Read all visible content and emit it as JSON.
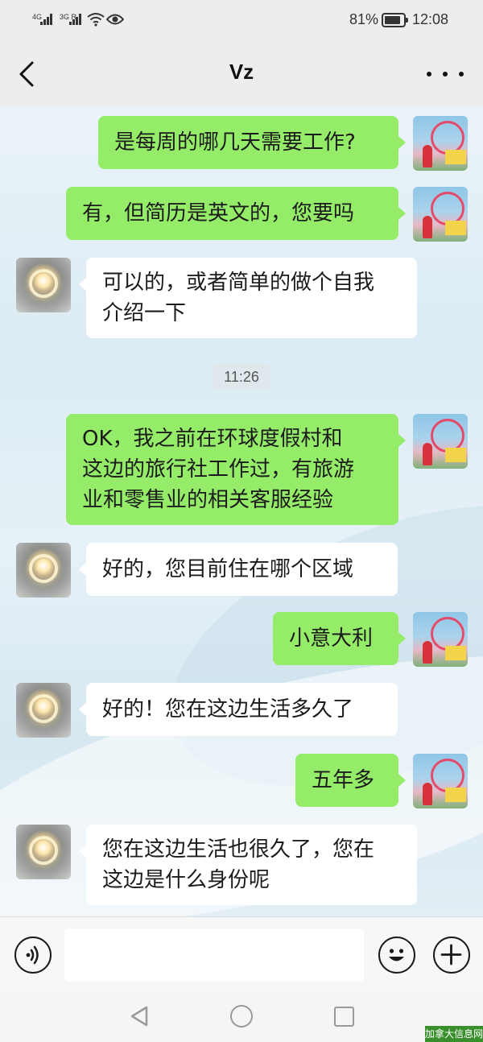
{
  "status_bar": {
    "sim1_label": "4G",
    "sim2_label": "3G R",
    "battery_percent": "81%",
    "time": "12:08",
    "icons": [
      "signal-4g-icon",
      "signal-3g-roaming-icon",
      "wifi-icon",
      "eye-comfort-icon",
      "battery-icon"
    ]
  },
  "header": {
    "title": "Vz",
    "back_icon": "chevron-left-icon",
    "more_icon": "more-dots-icon"
  },
  "messages": [
    {
      "sender": "self",
      "lines": [
        "是每周的哪几天需要工作?"
      ]
    },
    {
      "sender": "self",
      "lines": [
        "有，但简历是英文的，您要吗"
      ]
    },
    {
      "sender": "other",
      "lines": [
        "可以的，或者简单的做个自我",
        "介绍一下"
      ]
    },
    {
      "sender": "self",
      "lines": [
        "OK，我之前在环球度假村和",
        "这边的旅行社工作过，有旅游",
        "业和零售业的相关客服经验"
      ]
    },
    {
      "sender": "other",
      "lines": [
        "好的，您目前住在哪个区域"
      ]
    },
    {
      "sender": "self",
      "lines": [
        "小意大利"
      ]
    },
    {
      "sender": "other",
      "lines": [
        "好的！您在这边生活多久了"
      ]
    },
    {
      "sender": "self",
      "lines": [
        "五年多"
      ]
    },
    {
      "sender": "other",
      "lines": [
        "您在这边生活也很久了，您在",
        "这边是什么身份呢"
      ]
    }
  ],
  "timestamp": "11:26",
  "input_bar": {
    "placeholder": "",
    "value": "",
    "icons": [
      "voice-icon",
      "emoji-icon",
      "plus-icon"
    ]
  },
  "nav_bar": {
    "icons": [
      "nav-back-icon",
      "nav-home-icon",
      "nav-recent-icon"
    ]
  },
  "watermark": "加拿大信息网",
  "colors": {
    "self_bubble": "#95ec69",
    "other_bubble": "#ffffff",
    "header_bg": "#ededed"
  }
}
